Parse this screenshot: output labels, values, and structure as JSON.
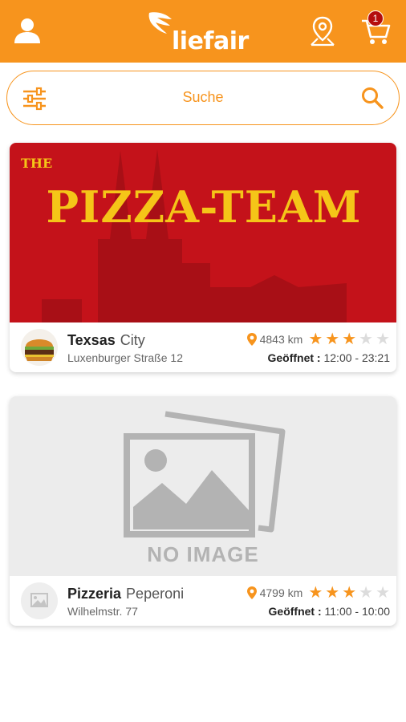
{
  "header": {
    "brand": "liefair",
    "cart_count": "1",
    "accent_color": "#f7941d"
  },
  "search": {
    "placeholder": "Suche"
  },
  "restaurants": [
    {
      "banner_text_top": "THE",
      "banner_text_main": "PIZZA-TEAM",
      "name_bold": "Texsas",
      "name_light": "City",
      "address": "Luxenburger Straße 12",
      "distance": "4843 km",
      "rating": 3,
      "hours_label": "Geöffnet :",
      "hours": "12:00 - 23:21"
    },
    {
      "banner_text_main": "NO IMAGE",
      "name_bold": "Pizzeria",
      "name_light": "Peperoni",
      "address": "Wilhelmstr. 77",
      "distance": "4799 km",
      "rating": 3,
      "hours_label": "Geöffnet :",
      "hours": "11:00 - 10:00"
    }
  ]
}
